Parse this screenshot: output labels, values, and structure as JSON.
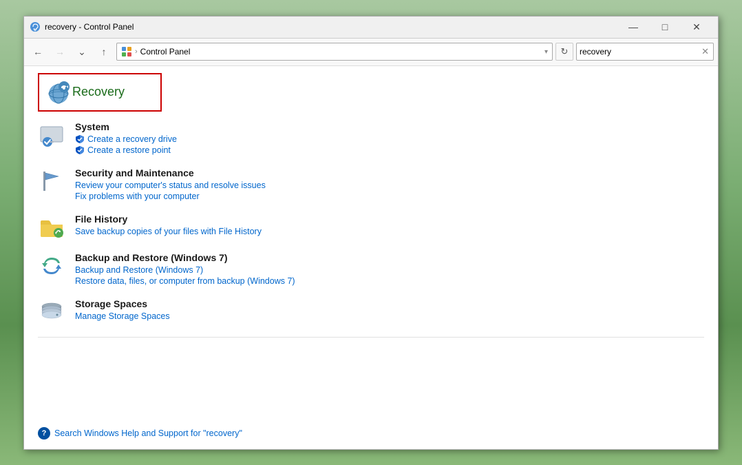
{
  "window": {
    "title": "recovery - Control Panel",
    "minimize_label": "—",
    "maximize_label": "□",
    "close_label": "✕"
  },
  "addressbar": {
    "back_label": "←",
    "forward_label": "→",
    "chevron_label": "⌄",
    "up_label": "↑",
    "path_icon_alt": "Control Panel",
    "separator": "›",
    "path_text": "Control Panel",
    "dropdown_label": "▾",
    "refresh_label": "↻",
    "search_value": "recovery",
    "search_clear_label": "✕"
  },
  "content": {
    "recovery_title": "Recovery",
    "sections": [
      {
        "id": "system",
        "title": "System",
        "links": [
          {
            "id": "create-recovery-drive",
            "label": "Create a recovery drive",
            "hasShield": true
          },
          {
            "id": "create-restore-point",
            "label": "Create a restore point",
            "hasShield": true
          }
        ]
      },
      {
        "id": "security-maintenance",
        "title": "Security and Maintenance",
        "links": [
          {
            "id": "review-status",
            "label": "Review your computer's status and resolve issues",
            "hasShield": false
          },
          {
            "id": "fix-problems",
            "label": "Fix problems with your computer",
            "hasShield": false
          }
        ]
      },
      {
        "id": "file-history",
        "title": "File History",
        "links": [
          {
            "id": "save-backup",
            "label": "Save backup copies of your files with File History",
            "hasShield": false
          }
        ]
      },
      {
        "id": "backup-restore",
        "title": "Backup and Restore (Windows 7)",
        "links": [
          {
            "id": "backup-restore-link",
            "label": "Backup and Restore (Windows 7)",
            "hasShield": false
          },
          {
            "id": "restore-data",
            "label": "Restore data, files, or computer from backup (Windows 7)",
            "hasShield": false
          }
        ]
      },
      {
        "id": "storage-spaces",
        "title": "Storage Spaces",
        "links": [
          {
            "id": "manage-storage",
            "label": "Manage Storage Spaces",
            "hasShield": false
          }
        ]
      }
    ],
    "help_text": "Search Windows Help and Support for \"recovery\""
  }
}
